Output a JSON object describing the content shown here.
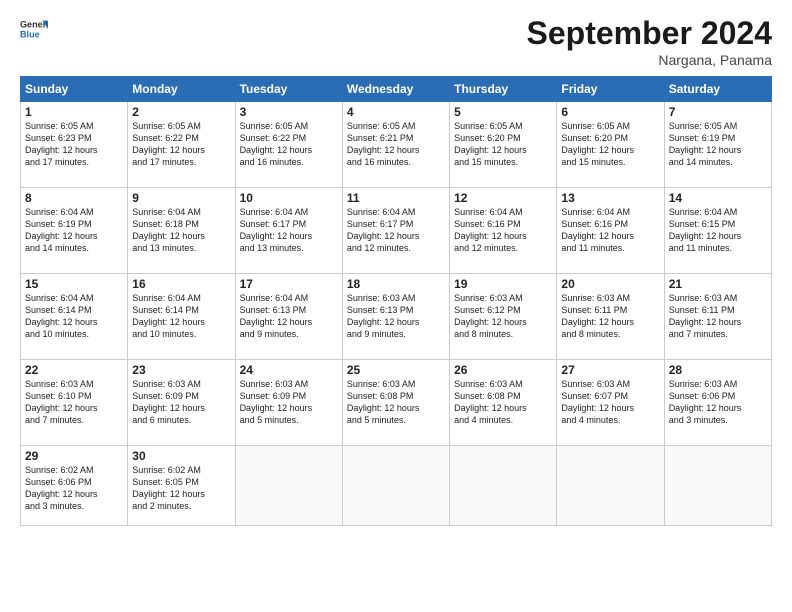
{
  "logo": {
    "general": "General",
    "blue": "Blue"
  },
  "title": "September 2024",
  "subtitle": "Nargana, Panama",
  "days_header": [
    "Sunday",
    "Monday",
    "Tuesday",
    "Wednesday",
    "Thursday",
    "Friday",
    "Saturday"
  ],
  "weeks": [
    [
      {
        "day": "1",
        "detail": "Sunrise: 6:05 AM\nSunset: 6:23 PM\nDaylight: 12 hours\nand 17 minutes."
      },
      {
        "day": "2",
        "detail": "Sunrise: 6:05 AM\nSunset: 6:22 PM\nDaylight: 12 hours\nand 17 minutes."
      },
      {
        "day": "3",
        "detail": "Sunrise: 6:05 AM\nSunset: 6:22 PM\nDaylight: 12 hours\nand 16 minutes."
      },
      {
        "day": "4",
        "detail": "Sunrise: 6:05 AM\nSunset: 6:21 PM\nDaylight: 12 hours\nand 16 minutes."
      },
      {
        "day": "5",
        "detail": "Sunrise: 6:05 AM\nSunset: 6:20 PM\nDaylight: 12 hours\nand 15 minutes."
      },
      {
        "day": "6",
        "detail": "Sunrise: 6:05 AM\nSunset: 6:20 PM\nDaylight: 12 hours\nand 15 minutes."
      },
      {
        "day": "7",
        "detail": "Sunrise: 6:05 AM\nSunset: 6:19 PM\nDaylight: 12 hours\nand 14 minutes."
      }
    ],
    [
      {
        "day": "8",
        "detail": "Sunrise: 6:04 AM\nSunset: 6:19 PM\nDaylight: 12 hours\nand 14 minutes."
      },
      {
        "day": "9",
        "detail": "Sunrise: 6:04 AM\nSunset: 6:18 PM\nDaylight: 12 hours\nand 13 minutes."
      },
      {
        "day": "10",
        "detail": "Sunrise: 6:04 AM\nSunset: 6:17 PM\nDaylight: 12 hours\nand 13 minutes."
      },
      {
        "day": "11",
        "detail": "Sunrise: 6:04 AM\nSunset: 6:17 PM\nDaylight: 12 hours\nand 12 minutes."
      },
      {
        "day": "12",
        "detail": "Sunrise: 6:04 AM\nSunset: 6:16 PM\nDaylight: 12 hours\nand 12 minutes."
      },
      {
        "day": "13",
        "detail": "Sunrise: 6:04 AM\nSunset: 6:16 PM\nDaylight: 12 hours\nand 11 minutes."
      },
      {
        "day": "14",
        "detail": "Sunrise: 6:04 AM\nSunset: 6:15 PM\nDaylight: 12 hours\nand 11 minutes."
      }
    ],
    [
      {
        "day": "15",
        "detail": "Sunrise: 6:04 AM\nSunset: 6:14 PM\nDaylight: 12 hours\nand 10 minutes."
      },
      {
        "day": "16",
        "detail": "Sunrise: 6:04 AM\nSunset: 6:14 PM\nDaylight: 12 hours\nand 10 minutes."
      },
      {
        "day": "17",
        "detail": "Sunrise: 6:04 AM\nSunset: 6:13 PM\nDaylight: 12 hours\nand 9 minutes."
      },
      {
        "day": "18",
        "detail": "Sunrise: 6:03 AM\nSunset: 6:13 PM\nDaylight: 12 hours\nand 9 minutes."
      },
      {
        "day": "19",
        "detail": "Sunrise: 6:03 AM\nSunset: 6:12 PM\nDaylight: 12 hours\nand 8 minutes."
      },
      {
        "day": "20",
        "detail": "Sunrise: 6:03 AM\nSunset: 6:11 PM\nDaylight: 12 hours\nand 8 minutes."
      },
      {
        "day": "21",
        "detail": "Sunrise: 6:03 AM\nSunset: 6:11 PM\nDaylight: 12 hours\nand 7 minutes."
      }
    ],
    [
      {
        "day": "22",
        "detail": "Sunrise: 6:03 AM\nSunset: 6:10 PM\nDaylight: 12 hours\nand 7 minutes."
      },
      {
        "day": "23",
        "detail": "Sunrise: 6:03 AM\nSunset: 6:09 PM\nDaylight: 12 hours\nand 6 minutes."
      },
      {
        "day": "24",
        "detail": "Sunrise: 6:03 AM\nSunset: 6:09 PM\nDaylight: 12 hours\nand 5 minutes."
      },
      {
        "day": "25",
        "detail": "Sunrise: 6:03 AM\nSunset: 6:08 PM\nDaylight: 12 hours\nand 5 minutes."
      },
      {
        "day": "26",
        "detail": "Sunrise: 6:03 AM\nSunset: 6:08 PM\nDaylight: 12 hours\nand 4 minutes."
      },
      {
        "day": "27",
        "detail": "Sunrise: 6:03 AM\nSunset: 6:07 PM\nDaylight: 12 hours\nand 4 minutes."
      },
      {
        "day": "28",
        "detail": "Sunrise: 6:03 AM\nSunset: 6:06 PM\nDaylight: 12 hours\nand 3 minutes."
      }
    ],
    [
      {
        "day": "29",
        "detail": "Sunrise: 6:02 AM\nSunset: 6:06 PM\nDaylight: 12 hours\nand 3 minutes."
      },
      {
        "day": "30",
        "detail": "Sunrise: 6:02 AM\nSunset: 6:05 PM\nDaylight: 12 hours\nand 2 minutes."
      },
      null,
      null,
      null,
      null,
      null
    ]
  ]
}
